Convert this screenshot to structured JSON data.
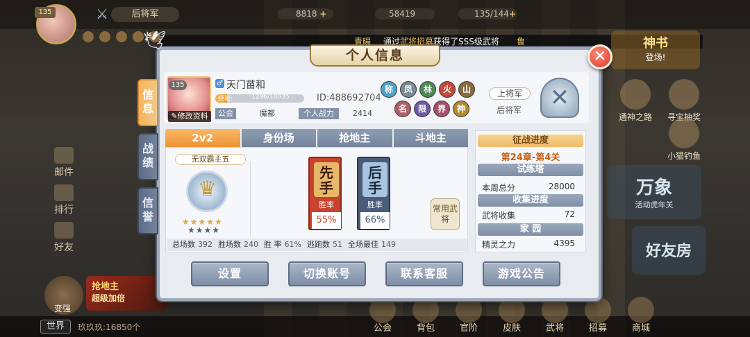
{
  "top_bar": {
    "player_level": "135",
    "rank_title": "后将军",
    "resources": [
      {
        "name": "copper-coin",
        "value": "8818",
        "has_plus": true
      },
      {
        "name": "gold-ingot",
        "value": "58419",
        "has_plus": false
      },
      {
        "name": "stamina",
        "value": "135/144",
        "has_plus": true
      }
    ]
  },
  "marquee": {
    "player": "青暘",
    "text_before": "通过",
    "highlight": "武将招募",
    "text_after": "获得了SSS级武将",
    "tail": "鲁"
  },
  "left_menu": [
    "邮件",
    "排行",
    "好友"
  ],
  "left_bottom": {
    "label": "变强",
    "promo_line1": "抢地主",
    "promo_line2": "超级加倍"
  },
  "right_menu": {
    "shen_book": "神书",
    "shen_book_sub": "登场!",
    "tongshen": "通神之路",
    "xunbao": "寻宝抽奖",
    "xiaomao": "小猫钓鱼",
    "wanxiang": "万象",
    "wanxiang_sub": "活动虎年关",
    "friend_room": "好友房"
  },
  "bottom_bar": {
    "world_label": "世界",
    "chat_preview": "玖玖玖:16850个",
    "nav": [
      "公会",
      "背包",
      "官阶",
      "皮肤",
      "武将",
      "招募",
      "商城"
    ]
  },
  "modal": {
    "title": "个人信息",
    "close_symbol": "✕",
    "side_tabs": [
      {
        "label": "信息",
        "active": true
      },
      {
        "label": "战绩",
        "active": false
      },
      {
        "label": "信誉",
        "active": false
      }
    ],
    "profile": {
      "level": "135",
      "name": "天门苗和",
      "gender_symbol": "♂",
      "edit_label": "修改资料",
      "exp_label": "经验:",
      "exp_text": "1296/10035",
      "exp_fraction": 0.129,
      "id_text": "ID:488692704",
      "guild_label": "公会",
      "guild_value": "魔都",
      "power_label": "个人战力",
      "power_value": "2414"
    },
    "badges": [
      {
        "char": "称",
        "color": "#4aa3c8"
      },
      {
        "char": "凤",
        "color": "#7a8a96"
      },
      {
        "char": "林",
        "color": "#4e8a56"
      },
      {
        "char": "火",
        "color": "#c24a3a"
      },
      {
        "char": "山",
        "color": "#8a6a3e"
      },
      {
        "char": "名",
        "color": "#b0606a"
      },
      {
        "char": "限",
        "color": "#6d5aa6"
      },
      {
        "char": "界",
        "color": "#a8506a"
      },
      {
        "char": "神",
        "color": "#b58a2a"
      }
    ],
    "rank": {
      "title": "上将军",
      "current": "后将军",
      "crest_symbol": "✕"
    },
    "mode_tabs": [
      {
        "label": "2v2",
        "active": true
      },
      {
        "label": "身份场",
        "active": false
      },
      {
        "label": "抢地主",
        "active": false
      },
      {
        "label": "斗地主",
        "active": false
      }
    ],
    "season_title": "无双霸主五",
    "stars_line1": "★★★★★",
    "stars_line2": "★★★★",
    "first_hand": {
      "label": "先手",
      "rate_label": "胜率",
      "rate": "55%"
    },
    "second_hand": {
      "label": "后手",
      "rate_label": "胜率",
      "rate": "66%"
    },
    "common_hero": "常用武将",
    "stats": [
      {
        "label": "总场数",
        "value": "392"
      },
      {
        "label": "胜场数",
        "value": "240"
      },
      {
        "label": "胜 率",
        "value": "61%"
      },
      {
        "label": "逃跑数",
        "value": "51"
      },
      {
        "label": "全场最佳",
        "value": "149"
      }
    ],
    "progress": {
      "campaign_header": "征战进度",
      "chapter": "第24章-第4关",
      "trial_header": "试练塔",
      "weekly_label": "本周总分",
      "weekly_value": "28000",
      "collect_header": "收集进度",
      "hero_collect_label": "武将收集",
      "hero_collect_value": "72",
      "home_header": "家 园",
      "spirit_label": "精灵之力",
      "spirit_value": "4395"
    },
    "footer_buttons": [
      "设置",
      "切换账号",
      "联系客服",
      "游戏公告"
    ]
  }
}
